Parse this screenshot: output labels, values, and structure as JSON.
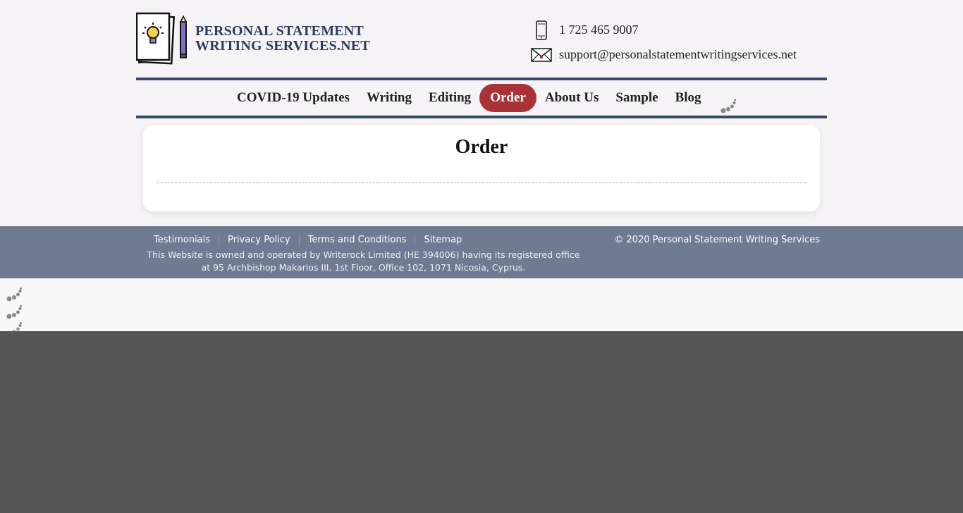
{
  "header": {
    "logo_line1": "PERSONAL STATEMENT",
    "logo_line2": "WRITING SERVICES.NET",
    "phone": "1 725 465 9007",
    "email": "support@personalstatementwritingservices.net"
  },
  "nav": {
    "items": [
      {
        "label": "COVID-19 Updates"
      },
      {
        "label": "Writing"
      },
      {
        "label": "Editing"
      },
      {
        "label": "Order"
      },
      {
        "label": "About Us"
      },
      {
        "label": "Sample"
      },
      {
        "label": "Blog"
      }
    ],
    "active": "Order"
  },
  "main": {
    "title": "Order"
  },
  "footer": {
    "links": [
      {
        "label": "Testimonials"
      },
      {
        "label": "Privacy Policy"
      },
      {
        "label": "Terms and Conditions"
      },
      {
        "label": "Sitemap"
      }
    ],
    "copyright": "© 2020 Personal Statement Writing Services",
    "ownership": "This Website is owned and operated by Writerock Limited (HE 394006) having its registered office at 95 Archbishop Makarios III, 1st Floor, Office 102, 1071 Nicosia, Cyprus."
  },
  "colors": {
    "accent": "#a83236",
    "nav_border": "#3b4a6b",
    "footer_bg": "#6f7b92",
    "logo_text": "#2c3a5c"
  },
  "icons": [
    "logo-icon",
    "phone-icon",
    "email-icon",
    "loading-spinner-icon"
  ]
}
